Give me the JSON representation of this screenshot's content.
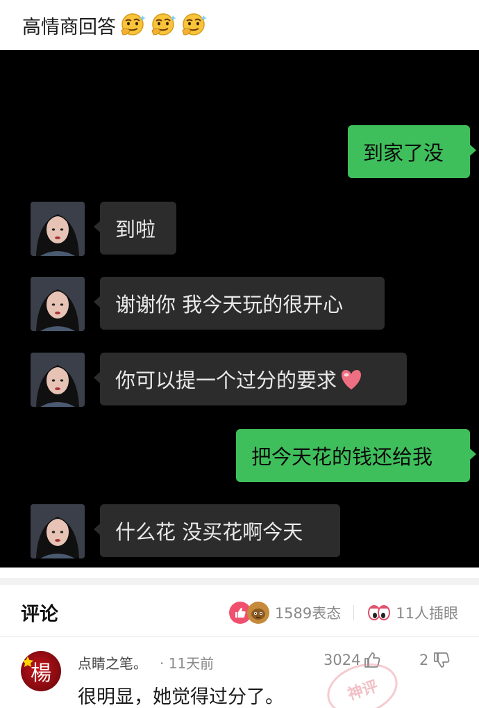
{
  "post": {
    "title": "高情商回答",
    "title_emojis": [
      "thinking-face-icon",
      "thinking-face-icon",
      "thinking-face-icon"
    ]
  },
  "chat": {
    "messages": [
      {
        "side": "right",
        "text": "到家了没"
      },
      {
        "side": "left",
        "text": "到啦"
      },
      {
        "side": "left",
        "text": "谢谢你 我今天玩的很开心"
      },
      {
        "side": "left",
        "text": "你可以提一个过分的要求",
        "emoji": "heart-icon"
      },
      {
        "side": "right",
        "text": "把今天花的钱还给我"
      },
      {
        "side": "left",
        "text": "什么花 没买花啊今天"
      }
    ],
    "colors": {
      "background": "#000000",
      "left_bubble": "#2c2c2c",
      "right_bubble": "#3fbf5c"
    }
  },
  "comments": {
    "header_label": "评论",
    "reactions_count": "1589表态",
    "eyes_count": "11人插眼",
    "items": [
      {
        "avatar_char": "楊",
        "username": "点睛之笔。",
        "time": "· 11天前",
        "likes": "3024",
        "dislikes": "2",
        "text": "很明显，她觉得过分了。",
        "stamp": "神评"
      }
    ]
  }
}
